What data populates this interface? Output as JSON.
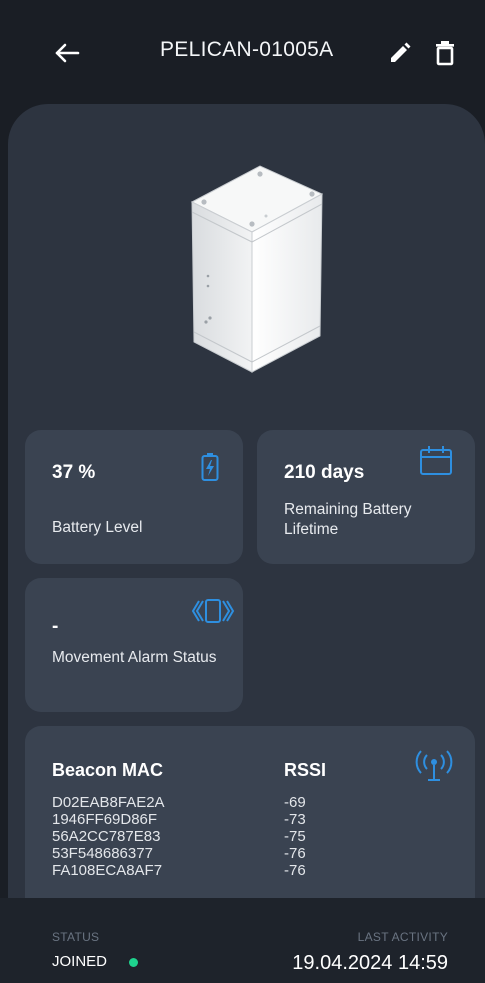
{
  "header": {
    "title": "PELICAN-01005A",
    "back_icon": "arrow-left-icon",
    "edit_icon": "pencil-icon",
    "delete_icon": "trash-icon"
  },
  "device": {
    "image_icon": "device-sensor-image"
  },
  "battery": {
    "value": "37 %",
    "label": "Battery Level",
    "icon": "battery-charging-icon"
  },
  "lifetime": {
    "value": "210 days",
    "label": "Remaining Battery Lifetime",
    "icon": "calendar-icon"
  },
  "movement": {
    "value": "-",
    "label": "Movement Alarm Status",
    "icon": "vibration-icon"
  },
  "beacons": {
    "col_mac": "Beacon MAC",
    "col_rssi": "RSSI",
    "icon": "antenna-signal-icon",
    "rows": [
      {
        "mac": "D02EAB8FAE2A",
        "rssi": "-69"
      },
      {
        "mac": "1946FF69D86F",
        "rssi": "-73"
      },
      {
        "mac": "56A2CC787E83",
        "rssi": "-75"
      },
      {
        "mac": "53F548686377",
        "rssi": "-76"
      },
      {
        "mac": "FA108ECA8AF7",
        "rssi": "-76"
      }
    ]
  },
  "footer": {
    "status_label": "STATUS",
    "status_value": "JOINED",
    "activity_label": "LAST ACTIVITY",
    "activity_value": "19.04.2024 14:59"
  },
  "colors": {
    "background": "#1a1e25",
    "panel": "#2d3440",
    "card": "#3a4351",
    "accent": "#2e8fe0",
    "status_ok": "#1ed38e"
  }
}
